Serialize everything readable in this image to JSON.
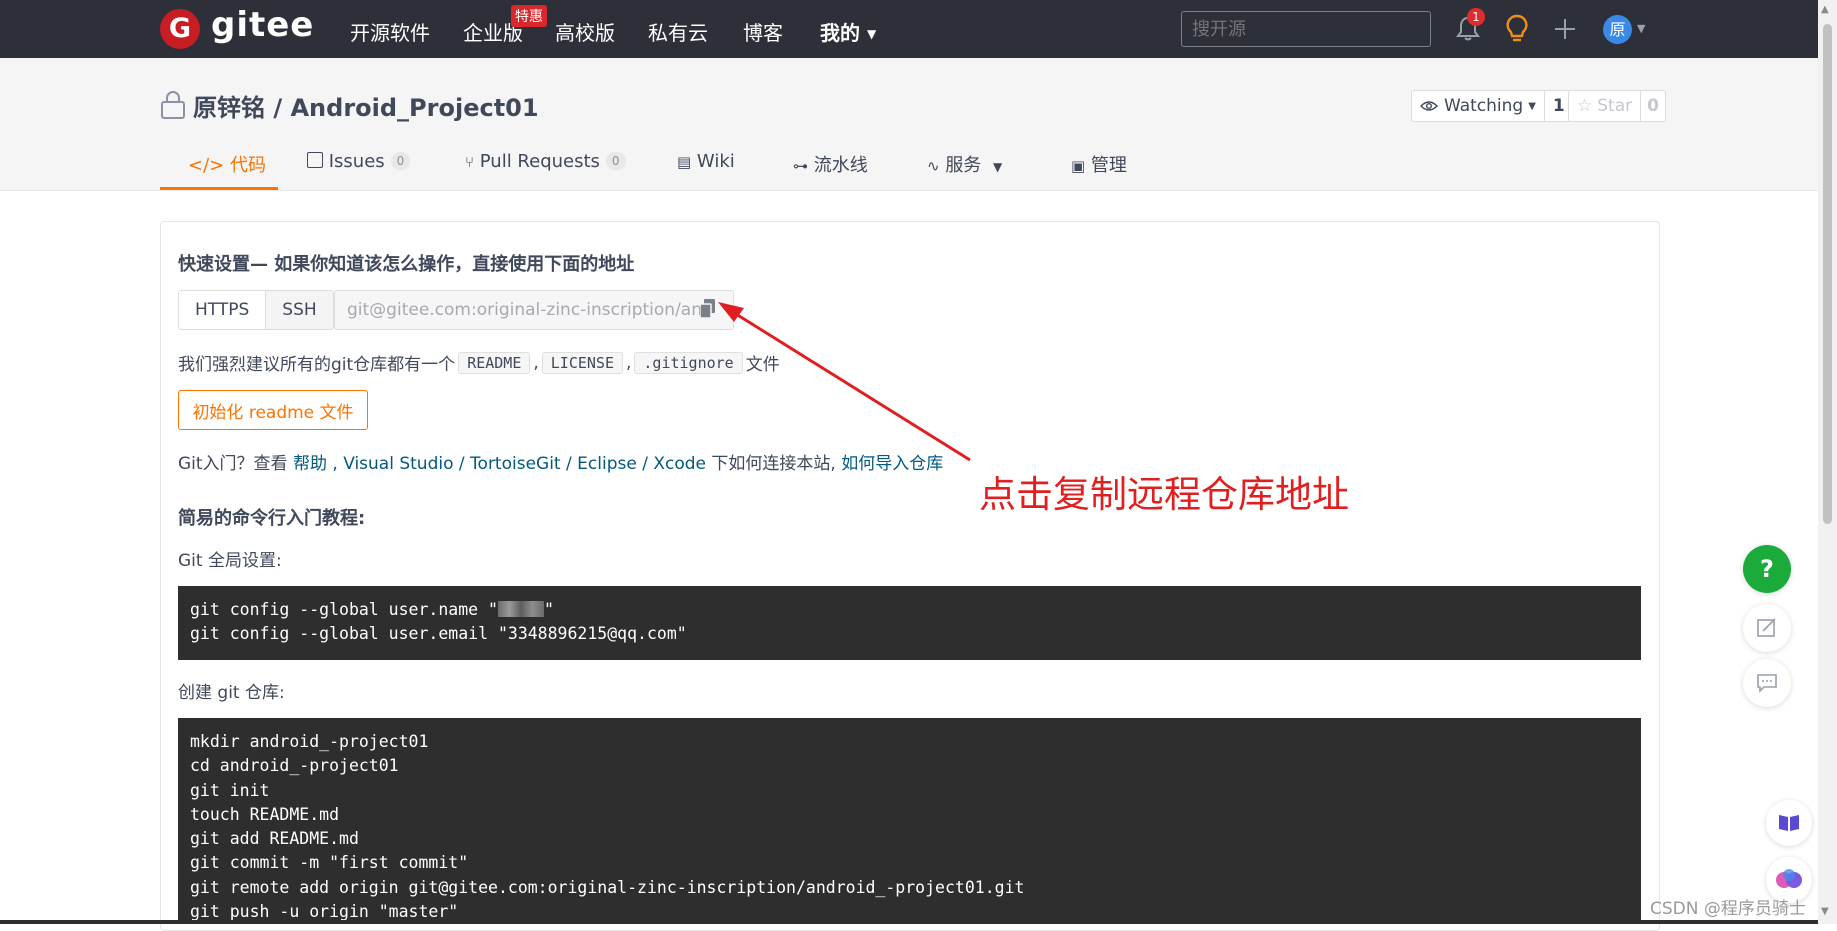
{
  "brand": {
    "logo_letter": "G",
    "name": "gitee"
  },
  "topnav": {
    "items": [
      "开源软件",
      "企业版",
      "高校版",
      "私有云",
      "博客",
      "我的"
    ],
    "special_badge": "特惠",
    "search_placeholder": "搜开源",
    "notification_count": "1",
    "avatar_text": "原"
  },
  "repo": {
    "owner": "原锌铭",
    "separator": " / ",
    "name": "Android_Project01",
    "watch_label": "Watching",
    "watch_count": "1",
    "star_label": "Star",
    "star_count": "0"
  },
  "tabs": [
    {
      "label": "代码",
      "icon": "code-icon",
      "active": true
    },
    {
      "label": "Issues",
      "count": "0",
      "icon": "issues-icon"
    },
    {
      "label": "Pull Requests",
      "count": "0",
      "icon": "pull-request-icon"
    },
    {
      "label": "Wiki",
      "icon": "wiki-icon"
    },
    {
      "label": "流水线",
      "icon": "pipeline-icon"
    },
    {
      "label": "服务",
      "icon": "service-icon"
    },
    {
      "label": "管理",
      "icon": "manage-icon"
    }
  ],
  "quick_setup": {
    "title": "快速设置— 如果你知道该怎么操作，直接使用下面的地址",
    "protocols": [
      "HTTPS",
      "SSH"
    ],
    "url": "git@gitee.com:original-zinc-inscription/and",
    "recommend_prefix": "我们强烈建议所有的git仓库都有一个",
    "recommend_files": [
      "README",
      "LICENSE",
      ".gitignore"
    ],
    "recommend_sep": ",",
    "recommend_suffix": "文件",
    "init_button": "初始化 readme 文件",
    "intro_prefix": "Git入门？查看",
    "intro_links": [
      "帮助",
      "Visual Studio",
      "TortoiseGit",
      "Eclipse",
      "Xcode"
    ],
    "intro_middle": "下如何连接本站,",
    "intro_import": "如何导入仓库"
  },
  "commands": {
    "title": "简易的命令行入门教程:",
    "global_label": "Git 全局设置:",
    "global_line1_prefix": "git config --global user.name \"",
    "global_line1_suffix": "\"",
    "global_line2": "git config --global user.email \"3348896215@qq.com\"",
    "create_label": "创建 git 仓库:",
    "create_lines": [
      "mkdir android_-project01",
      "cd android_-project01",
      "git init",
      "touch README.md",
      "git add README.md",
      "git commit -m \"first commit\"",
      "git remote add origin git@gitee.com:original-zinc-inscription/android_-project01.git",
      "git push -u origin \"master\""
    ]
  },
  "annotation": "点击复制远程仓库地址",
  "watermark": "CSDN @程序员骑士",
  "colors": {
    "nav_bg": "#2d3039",
    "brand_red": "#c71d23",
    "accent_orange": "#fe7300",
    "link": "#005980",
    "annotation_red": "#e02020",
    "help_green": "#1aab3b"
  }
}
